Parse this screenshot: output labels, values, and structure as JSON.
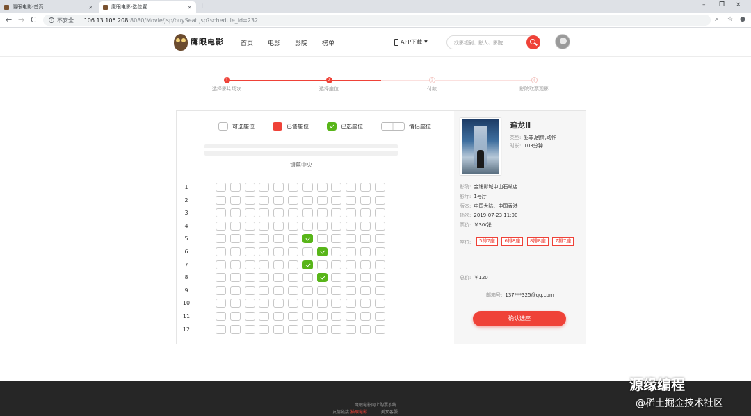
{
  "browser": {
    "tabs": [
      {
        "title": "鹰眼电影-首页",
        "close": "×"
      },
      {
        "title": "鹰眼电影-选位置",
        "close": "×"
      }
    ],
    "new_tab": "+",
    "back": "←",
    "forward": "→",
    "reload": "C",
    "insecure_label": "不安全",
    "url_host": "106.13.106.208",
    "url_rest": ":8080/Movie/Jsp/buySeat.jsp?schedule_id=232",
    "win_min": "–",
    "win_restore": "❐",
    "win_close": "×"
  },
  "header": {
    "logo_text": "鹰眼电影",
    "nav": [
      "首页",
      "电影",
      "影院",
      "榜单"
    ],
    "app_download": "APP下载",
    "search_placeholder": "找影视剧、影人、影院"
  },
  "steps": [
    {
      "num": "1",
      "label": "选择影片场次",
      "done": true
    },
    {
      "num": "2",
      "label": "选择座位",
      "done": true
    },
    {
      "num": "3",
      "label": "付款",
      "done": false
    },
    {
      "num": "4",
      "label": "影院取票观影",
      "done": false
    }
  ],
  "legend": {
    "available": "可选座位",
    "sold": "已售座位",
    "selected": "已选座位",
    "couple": "情侣座位"
  },
  "screen_label": "银幕中央",
  "seat_map": {
    "rows": [
      "1",
      "2",
      "3",
      "4",
      "5",
      "6",
      "7",
      "8",
      "9",
      "10",
      "11",
      "12"
    ],
    "cols": 12,
    "selected": [
      [
        5,
        7
      ],
      [
        6,
        8
      ],
      [
        7,
        7
      ],
      [
        8,
        8
      ]
    ]
  },
  "movie": {
    "title": "追龙II",
    "type_label": "类型:",
    "type": "犯罪,剧情,动作",
    "duration_label": "时长:",
    "duration": "103分钟",
    "cinema_label": "影院:",
    "cinema": "金逸影城中山石岐店",
    "hall_label": "影厅:",
    "hall": "1号厅",
    "version_label": "版本:",
    "version": "中国大陆、中国香港",
    "showtime_label": "场次:",
    "showtime": "2019-07-23 11:00",
    "price_label": "票价:",
    "price": "￥30/张",
    "seats_label": "座位:",
    "seats": [
      "5排7座",
      "6排8座",
      "8排8座",
      "7排7座"
    ],
    "total_label": "总价:",
    "total": "￥120",
    "email_label": "邮箱号:",
    "email": "137***325@qq.com",
    "confirm": "确认选座"
  },
  "footer": {
    "line1": "鹰眼电影网上购票系统",
    "line2_prefix": "友情链接",
    "line2_link": "猫眼电影",
    "line2_suffix": "美女客服"
  },
  "watermark": {
    "line1": "源缘编程",
    "line2": "@稀土掘金技术社区"
  },
  "colors": {
    "accent": "#ef4238",
    "selected": "#58b519"
  }
}
